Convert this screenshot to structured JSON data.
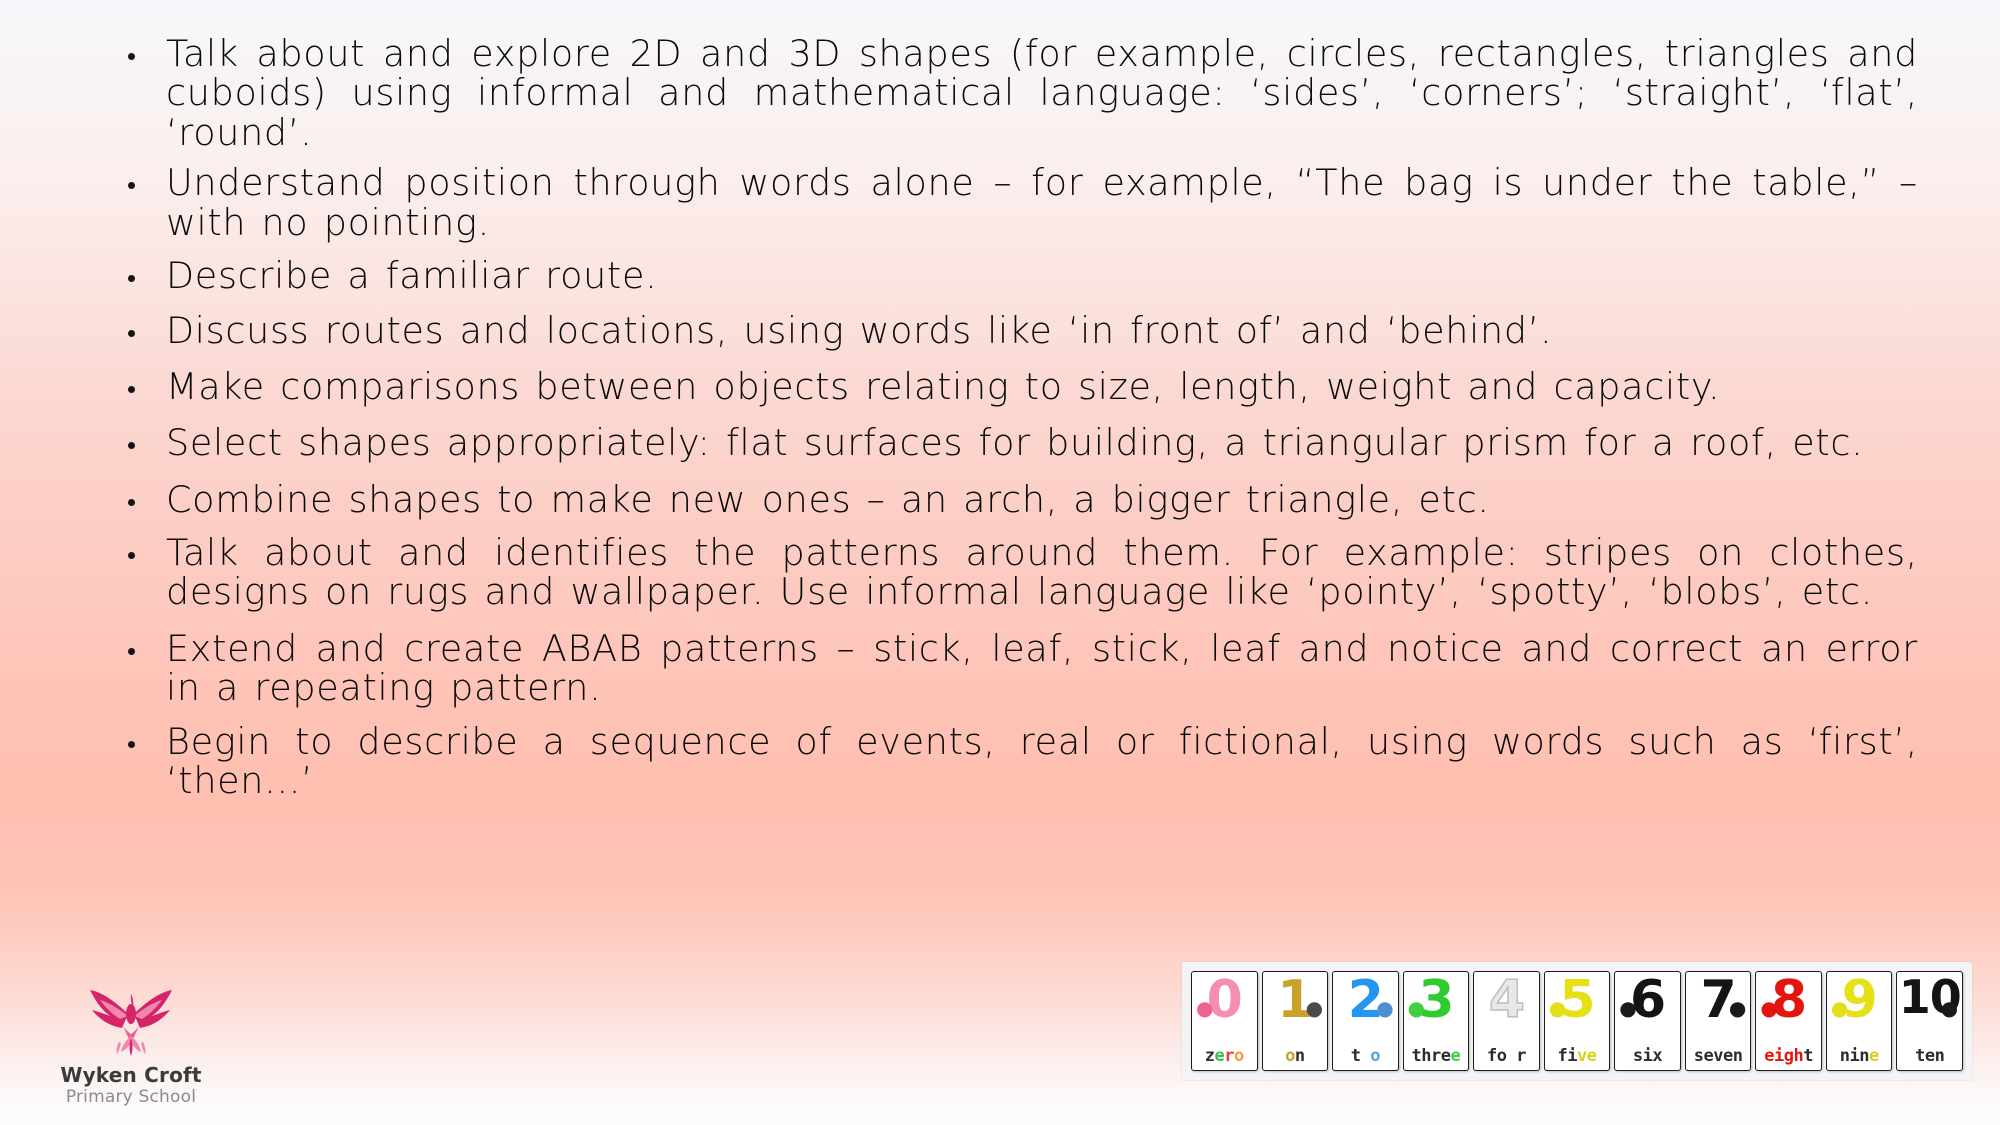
{
  "slide": {
    "background_top_color": "#f7f8fb",
    "background_mid_color": "#ffbfb1",
    "background_bottom_color": "#fbfbfd",
    "text_color": "#0a0a0a"
  },
  "bullets": [
    {
      "id": "shapes-2d-3d",
      "text": "Talk about and explore 2D and 3D shapes (for example, circles, rectangles, triangles and cuboids) using informal and mathematical language: ‘sides’, ‘corners’; ‘straight’, ‘flat’, ‘round’."
    },
    {
      "id": "position-words",
      "text": "Understand position through words alone – for example, “The bag is under the table,” – with no pointing."
    },
    {
      "id": "familiar-route",
      "text": "Describe a familiar route."
    },
    {
      "id": "routes-locations",
      "text": "Discuss routes and locations, using words like ‘in front of’ and ‘behind’."
    },
    {
      "id": "comparisons",
      "text": "Make comparisons between objects relating to size, length, weight and capacity."
    },
    {
      "id": "select-shapes",
      "text": "Select shapes appropriately: flat surfaces for building, a triangular prism for a roof, etc."
    },
    {
      "id": "combine-shapes",
      "text": "Combine shapes to make new ones – an arch, a bigger triangle, etc."
    },
    {
      "id": "patterns-around",
      "text": "Talk about and identifies the patterns around them. For example: stripes on clothes, designs on rugs and wallpaper. Use informal language like ‘pointy’, ‘spotty’, ‘blobs’, etc."
    },
    {
      "id": "abab-patterns",
      "text": "Extend and create ABAB patterns – stick, leaf, stick, leaf and notice and correct an error in a repeating pattern."
    },
    {
      "id": "sequence-events",
      "text": "Begin to describe a sequence of events, real or fictional, using words such as ‘first’, ‘then...’"
    }
  ],
  "logo": {
    "icon": "phoenix-bird-icon",
    "name": "Wyken Croft",
    "subtitle": "Primary School",
    "mark_color": "#d4256b",
    "mark_color_light": "#ef86ae",
    "name_color": "#3b3b3b",
    "subtitle_color": "#8d8a8a"
  },
  "number_cards": {
    "caption": "number-cards-0-to-10",
    "panel_color": "#f3f4f6",
    "cards": [
      {
        "digit": "0",
        "word": "zero",
        "digit_color": "#f48fb1",
        "word_colors": [
          "#2d2d2d",
          "#35c148",
          "#e8413d",
          "#f19a3e"
        ],
        "critter": "●",
        "critter_color": "#f06292",
        "critter_side": "l"
      },
      {
        "digit": "1",
        "word": "on",
        "digit_color": "#c9a227",
        "word_colors": [
          "#c9a227",
          "#2d2d2d"
        ],
        "critter": "●",
        "critter_color": "#4a4a4a",
        "critter_side": "r"
      },
      {
        "digit": "2",
        "word": "t o",
        "digit_color": "#2196f3",
        "word_colors": [
          "#2d2d2d",
          "#2d2d2d",
          "#4fa3e3"
        ],
        "critter": "●",
        "critter_color": "#4f8fd1",
        "critter_side": "r"
      },
      {
        "digit": "3",
        "word": "three",
        "digit_color": "#2ecc2e",
        "word_colors": [
          "#2d2d2d",
          "#2d2d2d",
          "#2d2d2d",
          "#2d2d2d",
          "#3fd03f"
        ],
        "critter": "●",
        "critter_color": "#3fcf3f",
        "critter_side": "l"
      },
      {
        "digit": "4",
        "word": "fo r",
        "digit_color": "#e8e8e8",
        "word_colors": [
          "#2d2d2d",
          "#2d2d2d",
          "#2d2d2d",
          "#2d2d2d"
        ],
        "critter": "",
        "critter_color": "#cccccc",
        "critter_side": "l"
      },
      {
        "digit": "5",
        "word": "five",
        "digit_color": "#e6e016",
        "word_colors": [
          "#2d2d2d",
          "#2d2d2d",
          "#d8d216",
          "#d8d216"
        ],
        "critter": "●",
        "critter_color": "#e3dd1a",
        "critter_side": "l"
      },
      {
        "digit": "6",
        "word": "six",
        "digit_color": "#141414",
        "word_colors": [
          "#2d2d2d",
          "#2d2d2d",
          "#2d2d2d"
        ],
        "critter": "●",
        "critter_color": "#1a1a1a",
        "critter_side": "l"
      },
      {
        "digit": "7",
        "word": "seven",
        "digit_color": "#141414",
        "word_colors": [
          "#2d2d2d",
          "#2d2d2d",
          "#2d2d2d",
          "#2d2d2d",
          "#2d2d2d"
        ],
        "critter": "●",
        "critter_color": "#1a1a1a",
        "critter_side": "r"
      },
      {
        "digit": "8",
        "word": "eight",
        "digit_color": "#e4150f",
        "word_colors": [
          "#e4150f",
          "#e4150f",
          "#e4150f",
          "#e4150f",
          "#2d2d2d"
        ],
        "critter": "●",
        "critter_color": "#e4150f",
        "critter_side": "l"
      },
      {
        "digit": "9",
        "word": "nine",
        "digit_color": "#e6e016",
        "word_colors": [
          "#2d2d2d",
          "#2d2d2d",
          "#2d2d2d",
          "#d8d216"
        ],
        "critter": "●",
        "critter_color": "#e3dd1a",
        "critter_side": "l"
      },
      {
        "digit": "10",
        "word": "ten",
        "digit_color": "#141414",
        "word_colors": [
          "#2d2d2d",
          "#2d2d2d",
          "#2d2d2d"
        ],
        "critter": "●",
        "critter_color": "#1a1a1a",
        "critter_side": "r"
      }
    ]
  }
}
